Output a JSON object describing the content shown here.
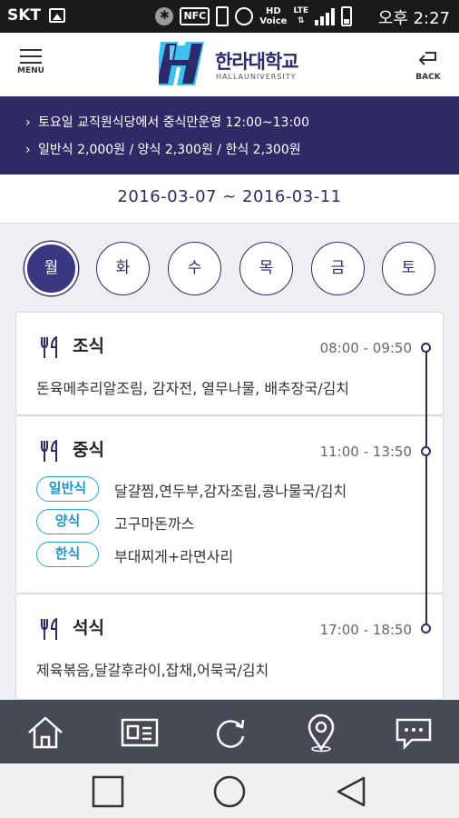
{
  "status_bar": {
    "carrier": "SKT",
    "nfc": "NFC",
    "hd": "HD",
    "voice": "Voice",
    "lte": "LTE",
    "time": "오후 2:27"
  },
  "header": {
    "menu_label": "MENU",
    "back_label": "BACK",
    "logo_korean": "한라대학교",
    "logo_english": "HALLAUNIVERSITY"
  },
  "notice": {
    "lines": [
      "토요일 교직원식당에서 중식만운영 12:00~13:00",
      "일반식 2,000원 / 양식 2,300원 / 한식 2,300원"
    ]
  },
  "date_range": "2016-03-07 ~ 2016-03-11",
  "days": [
    {
      "label": "월",
      "active": true
    },
    {
      "label": "화",
      "active": false
    },
    {
      "label": "수",
      "active": false
    },
    {
      "label": "목",
      "active": false
    },
    {
      "label": "금",
      "active": false
    },
    {
      "label": "토",
      "active": false
    }
  ],
  "meals": {
    "breakfast": {
      "title": "조식",
      "time": "08:00 - 09:50",
      "menu": "돈육메추리알조림, 감자전, 열무나물, 배추장국/김치"
    },
    "lunch": {
      "title": "중식",
      "time": "11:00 - 13:50",
      "options": [
        {
          "type": "일반식",
          "menu": "달걀찜,연두부,감자조림,콩나물국/김치"
        },
        {
          "type": "양식",
          "menu": "고구마돈까스"
        },
        {
          "type": "한식",
          "menu": "부대찌게+라면사리"
        }
      ]
    },
    "dinner": {
      "title": "석식",
      "time": "17:00 - 18:50",
      "menu": "제육볶음,달갈후라이,잡채,어묵국/김치"
    }
  },
  "icons": {
    "bottom_bar": [
      "home-icon",
      "news-icon",
      "refresh-icon",
      "location-icon",
      "chat-icon"
    ],
    "nav_bar": [
      "recent-apps-icon",
      "home-circle-icon",
      "back-triangle-icon"
    ]
  },
  "colors": {
    "primary": "#2f2a66",
    "accent": "#29a7df",
    "bottom_bar": "#474a55"
  }
}
